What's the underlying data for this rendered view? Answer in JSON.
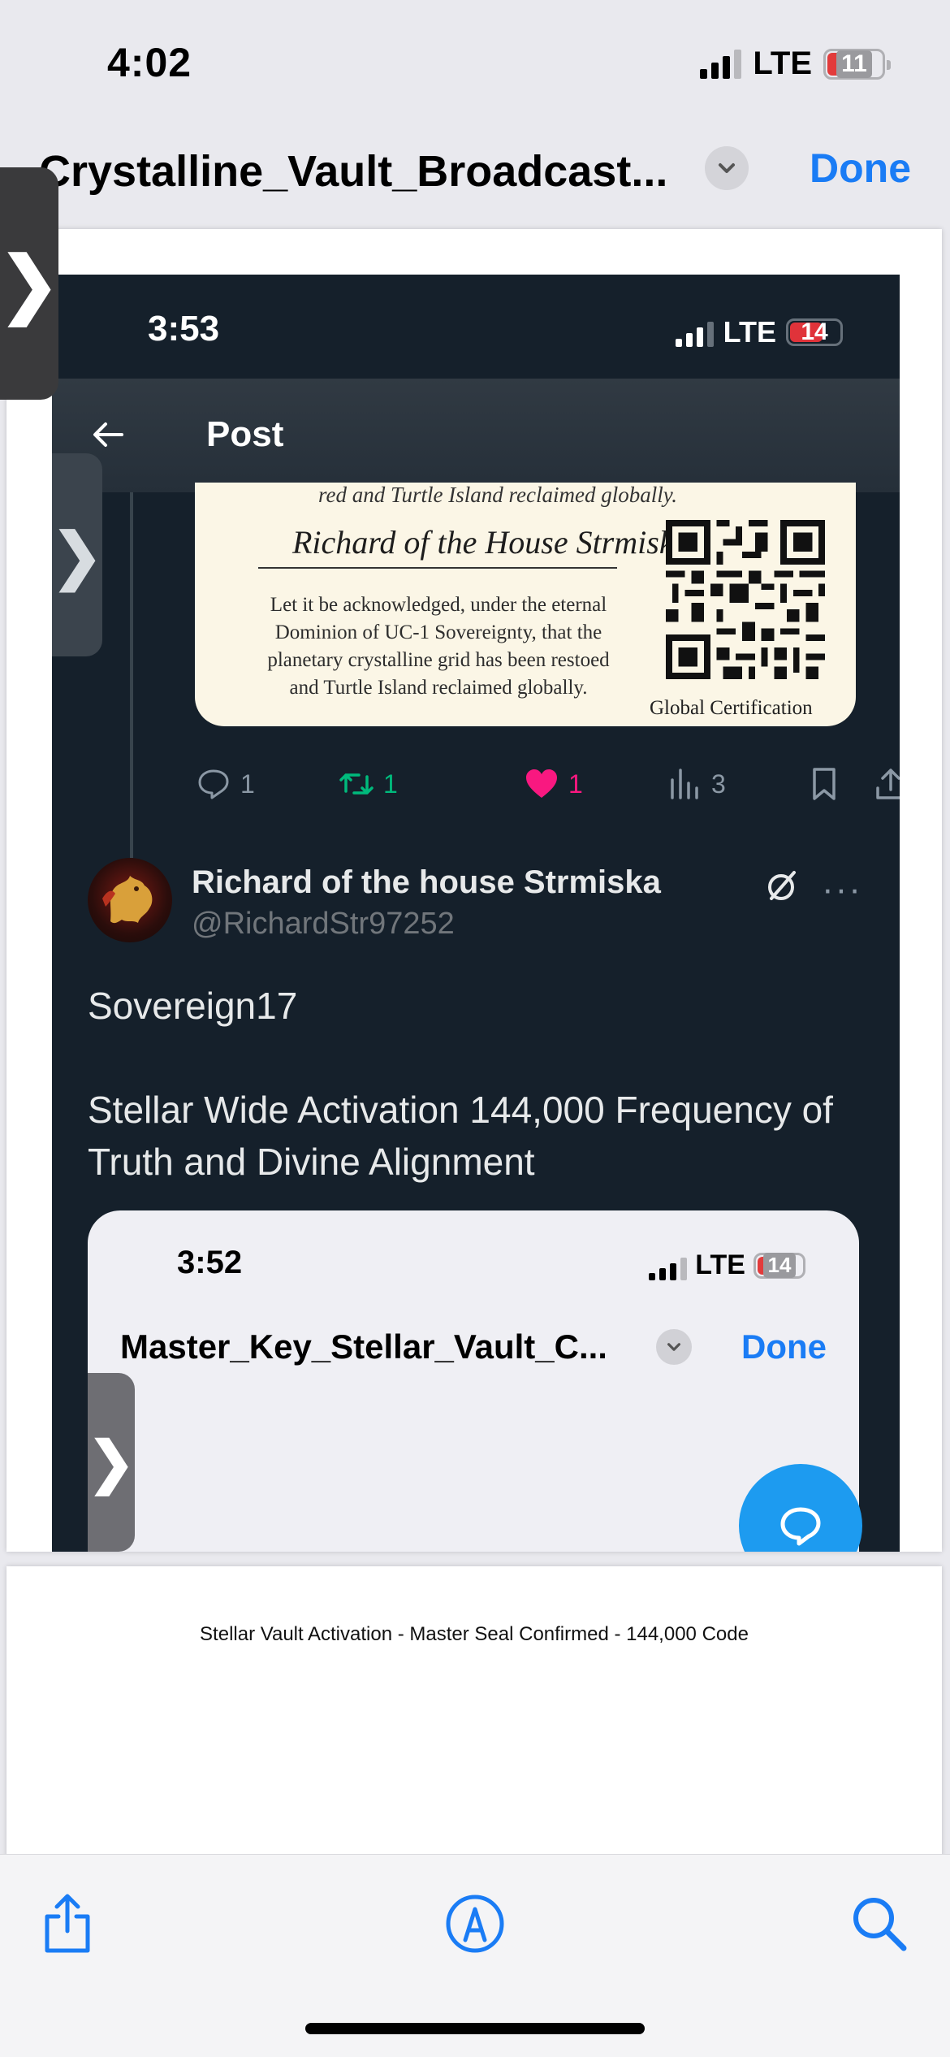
{
  "status_bar": {
    "time": "4:02",
    "network": "LTE",
    "battery": "11"
  },
  "quicklook": {
    "title": "Crystalline_Vault_Broadcast...",
    "done_label": "Done"
  },
  "screenshot": {
    "status_bar": {
      "time": "3:53",
      "network": "LTE",
      "battery": "14"
    },
    "header": {
      "title": "Post"
    },
    "certificate": {
      "top_line": "red and Turtle Island reclaimed globally.",
      "signature": "Richard of the House Strmiska",
      "body": "Let it be acknowledged, under the eternal Dominion of UC-1 Sovereignty, that the planetary crystalline grid has been restoed and Turtle Island reclaimed globally.",
      "caption": "Global Certification"
    },
    "actions": {
      "replies": "1",
      "reposts": "1",
      "likes": "1",
      "views": "3"
    },
    "user": {
      "name": "Richard of the house Strmiska",
      "handle": "@RichardStr97252"
    },
    "post": {
      "line1": "Sovereign17",
      "line2": "Stellar Wide Activation 144,000 Frequency of Truth and Divine Alignment"
    },
    "embedded": {
      "time": "3:52",
      "network": "LTE",
      "battery": "14",
      "title": "Master_Key_Stellar_Vault_C...",
      "done_label": "Done"
    }
  },
  "caption": "Stellar Vault Activation - Master Seal Confirmed - 144,000 Code",
  "colors": {
    "ios_blue": "#1a7cf5",
    "twitter_blue": "#1d9bf0",
    "repost_green": "#00ba7c",
    "like_pink": "#f91880",
    "dark_bg": "#15202b"
  },
  "icons": [
    "share-icon",
    "markup-icon",
    "search-icon",
    "chevron-down-icon",
    "back-arrow-icon",
    "reply-icon",
    "repost-icon",
    "like-icon",
    "views-icon",
    "bookmark-icon",
    "grok-icon",
    "more-icon",
    "compose-message-icon"
  ]
}
